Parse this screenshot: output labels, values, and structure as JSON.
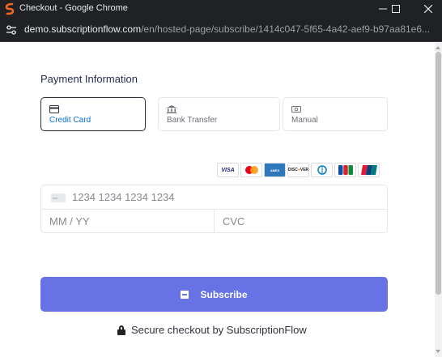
{
  "window": {
    "title": "Checkout - Google Chrome"
  },
  "address_bar": {
    "host": "demo.subscriptionflow.com",
    "path": "/en/hosted-page/subscribe/1414c047-5f65-4a42-aef9-b97aa81e6..."
  },
  "payment": {
    "heading": "Payment Information",
    "tabs": [
      {
        "label": "Credit Card",
        "icon": "credit-card-icon",
        "selected": true
      },
      {
        "label": "Bank Transfer",
        "icon": "bank-icon",
        "selected": false
      },
      {
        "label": "Manual",
        "icon": "cash-icon",
        "selected": false
      }
    ],
    "accepted_cards": [
      "VISA",
      "MasterCard",
      "AMERICAN EXPRESS",
      "DISCOVER",
      "Diners Club",
      "JCB",
      "UnionPay"
    ],
    "card_number_placeholder": "1234 1234 1234 1234",
    "expiry_placeholder": "MM / YY",
    "cvc_placeholder": "CVC",
    "subscribe_label": "Subscribe",
    "secure_text": "Secure checkout by SubscriptionFlow"
  },
  "colors": {
    "accent": "#6772e5",
    "chrome_bar": "#202124",
    "selected_tab_text": "#0570de"
  }
}
